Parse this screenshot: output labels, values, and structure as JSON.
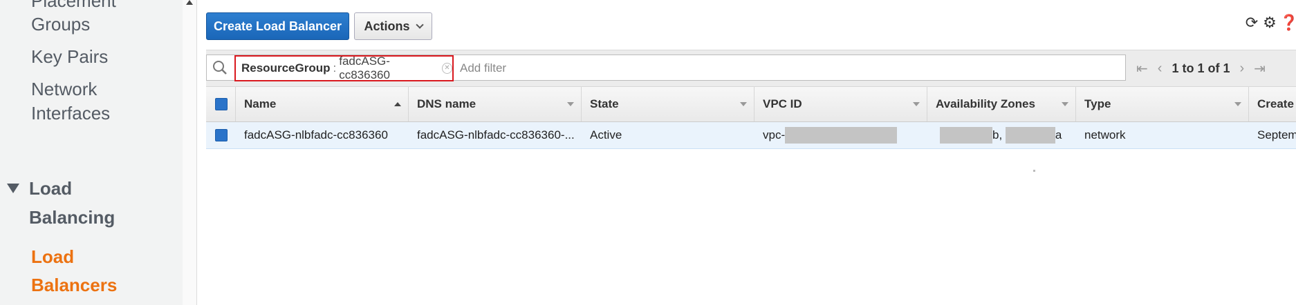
{
  "sidebar": {
    "items": [
      {
        "label": "Placement"
      },
      {
        "label": "Groups"
      },
      {
        "label": "Key Pairs"
      },
      {
        "label": "Network"
      },
      {
        "label": "Interfaces"
      }
    ],
    "section": {
      "line1": "Load",
      "line2": "Balancing"
    },
    "active": {
      "line1": "Load",
      "line2": "Balancers"
    }
  },
  "toolbar": {
    "create_label": "Create Load Balancer",
    "actions_label": "Actions"
  },
  "icons": {
    "refresh": "refresh-icon",
    "settings": "gear-icon",
    "help": "help-icon",
    "search": "search-icon"
  },
  "filter": {
    "key": "ResourceGroup",
    "separator": ":",
    "value": "fadcASG-cc836360",
    "placeholder": "Add filter"
  },
  "pagination": {
    "range_text": "1 to 1 of 1"
  },
  "table": {
    "columns": [
      "Name",
      "DNS name",
      "State",
      "VPC ID",
      "Availability Zones",
      "Type",
      "Create"
    ],
    "rows": [
      {
        "name": "fadcASG-nlbfadc-cc836360",
        "dns": "fadcASG-nlbfadc-cc836360-...",
        "state": "Active",
        "vpc_prefix": "vpc-",
        "az_1_suffix": "b,",
        "az_2_suffix": "a",
        "type": "network",
        "created": "Septem"
      }
    ]
  },
  "colors": {
    "accent": "#ec7211",
    "primary_button": "#2a73c9",
    "highlight_border": "#d9181e"
  }
}
